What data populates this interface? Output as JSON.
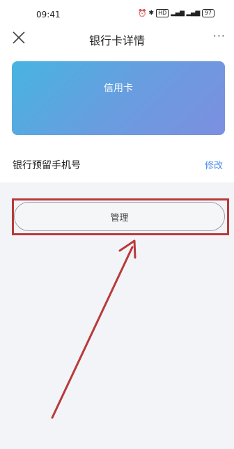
{
  "status_bar": {
    "time": "09:41",
    "battery": "97"
  },
  "nav": {
    "title": "银行卡详情",
    "more_label": "···"
  },
  "card": {
    "label": "信用卡"
  },
  "phone_row": {
    "label": "银行预留手机号",
    "action": "修改"
  },
  "manage": {
    "label": "管理"
  },
  "annotation": {
    "color": "#b83a3a"
  }
}
